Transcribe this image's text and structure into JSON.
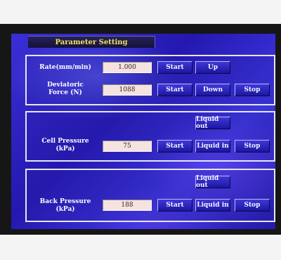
{
  "title": "Parameter Setting",
  "rate": {
    "label": "Rate(mm/min)",
    "value": "1.000",
    "start_label": "Start",
    "up_label": "Up"
  },
  "deviatoric": {
    "label_line1": "Deviatoric",
    "label_line2": "Force (N)",
    "value": "1088",
    "start_label": "Start",
    "down_label": "Down",
    "stop_label": "Stop"
  },
  "cell": {
    "label_line1": "Cell Pressure",
    "label_line2": "(kPa)",
    "value": "75",
    "liquid_out_label": "Liquid out",
    "start_label": "Start",
    "liquid_in_label": "Liquid in",
    "stop_label": "Stop"
  },
  "back": {
    "label_line1": "Back Pressure",
    "label_line2": "(kPa)",
    "value": "188",
    "liquid_out_label": "Liquid out",
    "start_label": "Start",
    "liquid_in_label": "Liquid in",
    "stop_label": "Stop"
  },
  "colors": {
    "title_text": "#f2e25a",
    "screen_blue": "#3a2fd6",
    "value_field": "#f6e2de",
    "bezel": "#161616"
  }
}
